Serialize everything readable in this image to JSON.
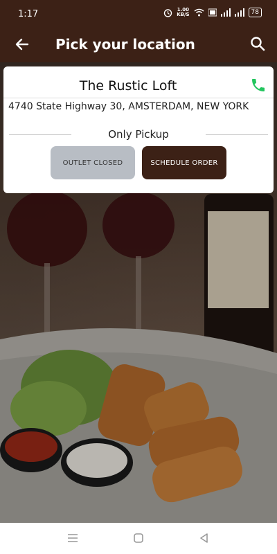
{
  "status_bar": {
    "time": "1:17",
    "speed_value": "1.00",
    "speed_unit": "KB/S",
    "battery": "78"
  },
  "toolbar": {
    "title": "Pick your location",
    "back_icon": "arrow-left-icon",
    "search_icon": "search-icon"
  },
  "outlet": {
    "name": "The Rustic Loft",
    "address": "4740 State Highway 30, AMSTERDAM, NEW YORK",
    "mode": "Only Pickup",
    "phone_icon": "phone-icon",
    "phone_color": "#22c55e"
  },
  "buttons": {
    "closed_label": "OUTLET CLOSED",
    "schedule_label": "SCHEDULE ORDER"
  },
  "colors": {
    "brand": "#3c2116",
    "disabled": "#b8bdc4"
  }
}
